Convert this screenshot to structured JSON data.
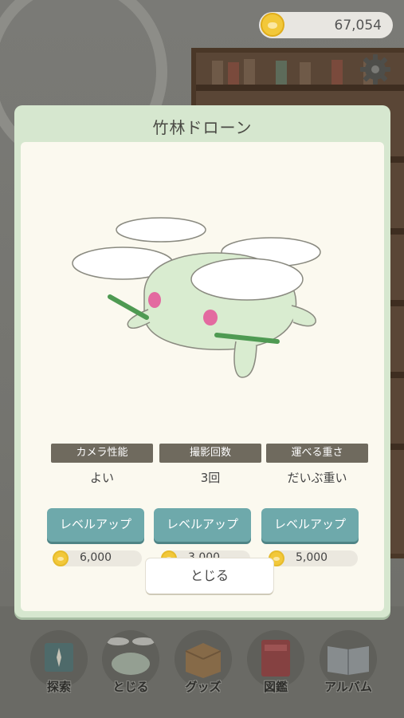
{
  "coins": {
    "amount": "67,054"
  },
  "modal": {
    "title": "竹林ドローン",
    "stats": [
      {
        "label": "カメラ性能",
        "value": "よい",
        "button": "レベルアップ",
        "cost": "6,000"
      },
      {
        "label": "撮影回数",
        "value": "3回",
        "button": "レベルアップ",
        "cost": "3,000"
      },
      {
        "label": "運べる重さ",
        "value": "だいぶ重い",
        "button": "レベルアップ",
        "cost": "5,000"
      }
    ],
    "close_label": "とじる"
  },
  "nav": [
    {
      "label": "探索",
      "icon": "map-icon"
    },
    {
      "label": "とじる",
      "icon": "drone-icon"
    },
    {
      "label": "グッズ",
      "icon": "box-icon"
    },
    {
      "label": "図鑑",
      "icon": "book-icon"
    },
    {
      "label": "アルバム",
      "icon": "album-icon"
    }
  ],
  "colors": {
    "accent": "#6ea9ab",
    "modal_frame": "#d6e7cf",
    "panel": "#fbf9ef",
    "label_bg": "#6f6a5e",
    "coin": "#f2c83a"
  }
}
